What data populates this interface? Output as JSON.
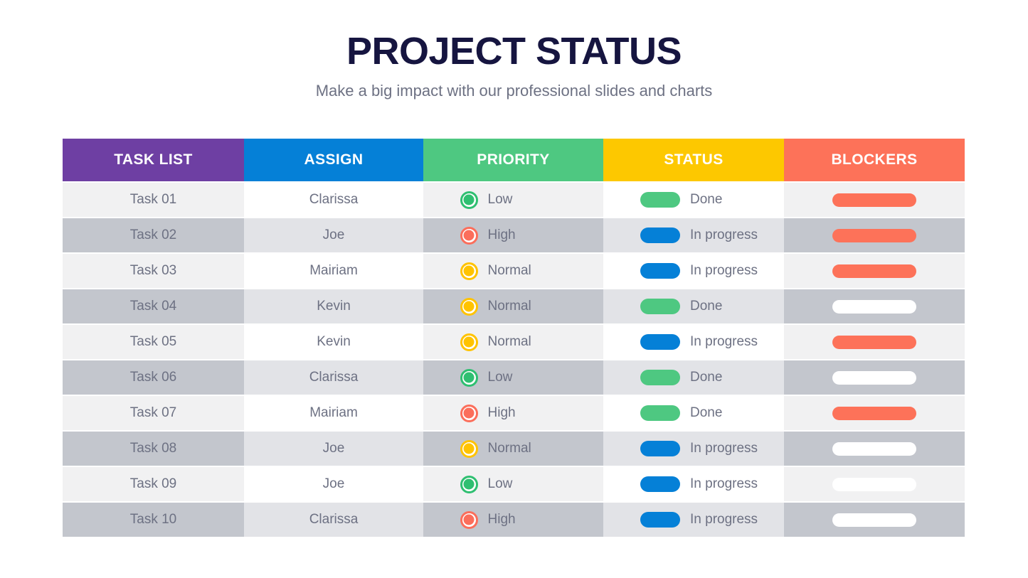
{
  "header": {
    "title": "PROJECT STATUS",
    "subtitle": "Make a big impact with our professional slides and charts"
  },
  "colors": {
    "purple": "#6e3fa3",
    "blue": "#0580d7",
    "green": "#4ec881",
    "yellow": "#fdc800",
    "red": "#fd7259",
    "white": "#ffffff",
    "title": "#161540",
    "text": "#6d7183",
    "row_light_odd": "#f1f1f2",
    "row_light_even": "#ffffff",
    "row_dark_odd": "#c3c6cd",
    "row_dark_even": "#e2e3e7"
  },
  "table": {
    "columns": [
      {
        "label": "TASK LIST",
        "color": "#6e3fa3"
      },
      {
        "label": "ASSIGN",
        "color": "#0580d7"
      },
      {
        "label": "PRIORITY",
        "color": "#4ec881"
      },
      {
        "label": "STATUS",
        "color": "#fdc800"
      },
      {
        "label": "BLOCKERS",
        "color": "#fd7259"
      }
    ],
    "rows": [
      {
        "task": "Task 01",
        "assign": "Clarissa",
        "priority": "Low",
        "priority_color": "#2fbf71",
        "priority_icon": "circle-indicator-icon",
        "status": "Done",
        "status_color": "#4ec881",
        "status_icon": "status-pill-done",
        "blocker": "",
        "blocker_color": "#fd7259",
        "blocker_icon": "blocker-bar-active",
        "shade": "light"
      },
      {
        "task": "Task 02",
        "assign": "Joe",
        "priority": "High",
        "priority_color": "#fb6e5b",
        "priority_icon": "circle-indicator-icon",
        "status": "In progress",
        "status_color": "#0580d7",
        "status_icon": "status-pill-in-progress",
        "blocker": "",
        "blocker_color": "#fd7259",
        "blocker_icon": "blocker-bar-active",
        "shade": "dark"
      },
      {
        "task": "Task 03",
        "assign": "Mairiam",
        "priority": "Normal",
        "priority_color": "#ffc300",
        "priority_icon": "circle-indicator-icon",
        "status": "In progress",
        "status_color": "#0580d7",
        "status_icon": "status-pill-in-progress",
        "blocker": "",
        "blocker_color": "#fd7259",
        "blocker_icon": "blocker-bar-active",
        "shade": "light"
      },
      {
        "task": "Task 04",
        "assign": "Kevin",
        "priority": "Normal",
        "priority_color": "#ffc300",
        "priority_icon": "circle-indicator-icon",
        "status": "Done",
        "status_color": "#4ec881",
        "status_icon": "status-pill-done",
        "blocker": "",
        "blocker_color": "#ffffff",
        "blocker_icon": "blocker-bar-empty",
        "shade": "dark"
      },
      {
        "task": "Task 05",
        "assign": "Kevin",
        "priority": "Normal",
        "priority_color": "#ffc300",
        "priority_icon": "circle-indicator-icon",
        "status": "In progress",
        "status_color": "#0580d7",
        "status_icon": "status-pill-in-progress",
        "blocker": "",
        "blocker_color": "#fd7259",
        "blocker_icon": "blocker-bar-active",
        "shade": "light"
      },
      {
        "task": "Task 06",
        "assign": "Clarissa",
        "priority": "Low",
        "priority_color": "#2fbf71",
        "priority_icon": "circle-indicator-icon",
        "status": "Done",
        "status_color": "#4ec881",
        "status_icon": "status-pill-done",
        "blocker": "",
        "blocker_color": "#ffffff",
        "blocker_icon": "blocker-bar-empty",
        "shade": "dark"
      },
      {
        "task": "Task 07",
        "assign": "Mairiam",
        "priority": "High",
        "priority_color": "#fb6e5b",
        "priority_icon": "circle-indicator-icon",
        "status": "Done",
        "status_color": "#4ec881",
        "status_icon": "status-pill-done",
        "blocker": "",
        "blocker_color": "#fd7259",
        "blocker_icon": "blocker-bar-active",
        "shade": "light"
      },
      {
        "task": "Task 08",
        "assign": "Joe",
        "priority": "Normal",
        "priority_color": "#ffc300",
        "priority_icon": "circle-indicator-icon",
        "status": "In progress",
        "status_color": "#0580d7",
        "status_icon": "status-pill-in-progress",
        "blocker": "",
        "blocker_color": "#ffffff",
        "blocker_icon": "blocker-bar-empty",
        "shade": "dark"
      },
      {
        "task": "Task 09",
        "assign": "Joe",
        "priority": "Low",
        "priority_color": "#2fbf71",
        "priority_icon": "circle-indicator-icon",
        "status": "In progress",
        "status_color": "#0580d7",
        "status_icon": "status-pill-in-progress",
        "blocker": "",
        "blocker_color": "#ffffff",
        "blocker_icon": "blocker-bar-empty",
        "shade": "light"
      },
      {
        "task": "Task 10",
        "assign": "Clarissa",
        "priority": "High",
        "priority_color": "#fb6e5b",
        "priority_icon": "circle-indicator-icon",
        "status": "In progress",
        "status_color": "#0580d7",
        "status_icon": "status-pill-in-progress",
        "blocker": "",
        "blocker_color": "#ffffff",
        "blocker_icon": "blocker-bar-empty",
        "shade": "dark"
      }
    ]
  }
}
